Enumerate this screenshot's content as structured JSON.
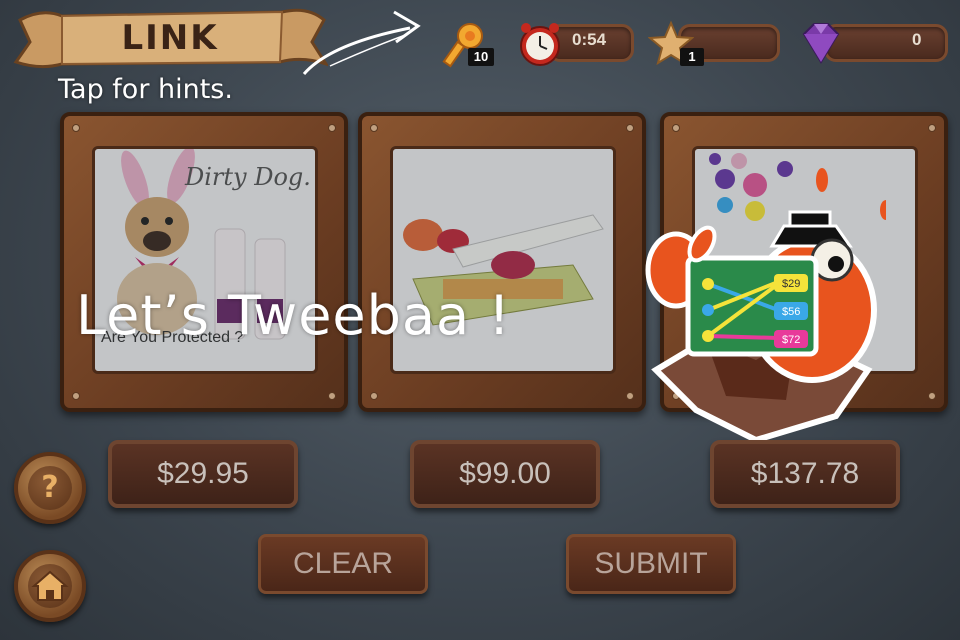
{
  "banner": {
    "title": "LINK"
  },
  "hint": {
    "text": "Tap for hints."
  },
  "hud": {
    "hint_keys": "10",
    "timer": "0:54",
    "stars": "1",
    "gems": "0"
  },
  "products": [
    {
      "brand": "Dirty Dog.",
      "caption": "Are You Protected ?"
    },
    {
      "brand": "",
      "caption": ""
    },
    {
      "brand": "",
      "caption": ""
    }
  ],
  "prices": [
    "$29.95",
    "$99.00",
    "$137.78"
  ],
  "actions": {
    "clear": "CLEAR",
    "submit": "SUBMIT"
  },
  "help_button": {
    "label": "?"
  },
  "overlay": {
    "title": "Let’s Tweebaa !"
  },
  "mascot_board": {
    "prices": [
      "$29",
      "$56",
      "$72"
    ]
  },
  "colors": {
    "background": "#3d464f",
    "wood": "#6b3d22",
    "banner_text": "#3a2316",
    "price_text": "#c8c0ba",
    "line_yellow": "#f5e33a",
    "line_blue": "#3aa8e8",
    "line_pink": "#e83a9a"
  },
  "icons": {
    "hint": "key-icon",
    "timer": "alarm-clock-icon",
    "star": "star-icon",
    "gem": "gem-icon",
    "help": "question-mark-icon",
    "home": "home-icon"
  }
}
